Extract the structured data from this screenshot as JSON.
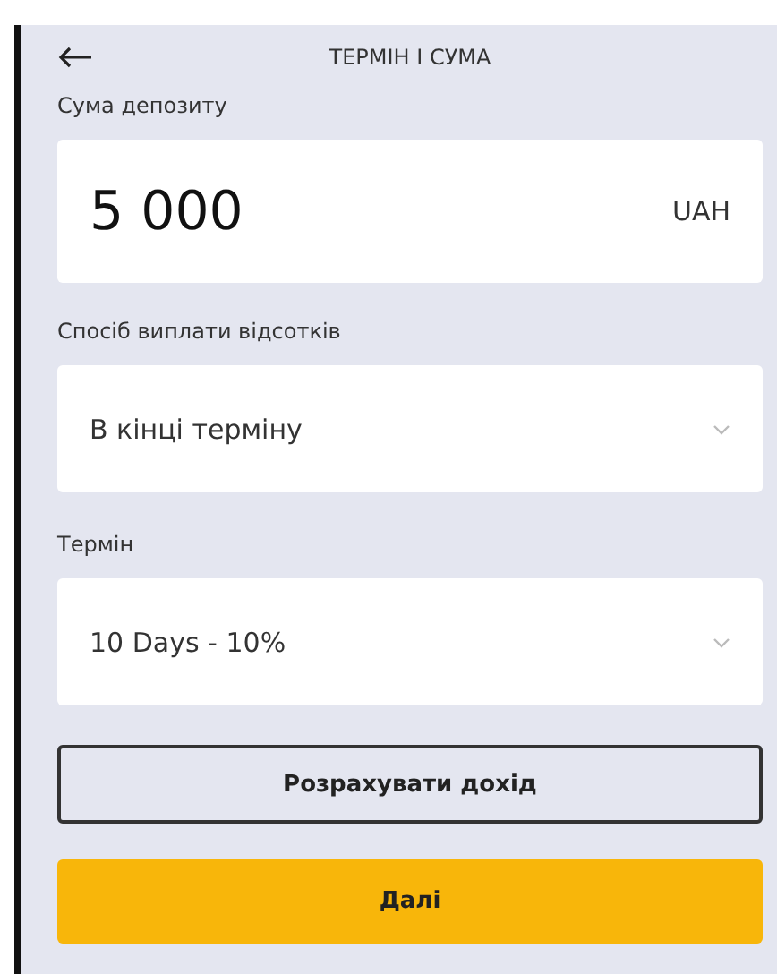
{
  "header": {
    "title": "ТЕРМІН І СУМА"
  },
  "amount": {
    "label": "Сума депозиту",
    "value": "5 000",
    "currency": "UAH"
  },
  "fields": [
    {
      "label": "Спосіб виплати відсотків",
      "value": "В кінці терміну"
    },
    {
      "label": "Термін",
      "value": "10 Days - 10%"
    }
  ],
  "buttons": [
    {
      "label": "Розрахувати дохід",
      "kind": "outline"
    },
    {
      "label": "Далі",
      "kind": "primary"
    }
  ]
}
